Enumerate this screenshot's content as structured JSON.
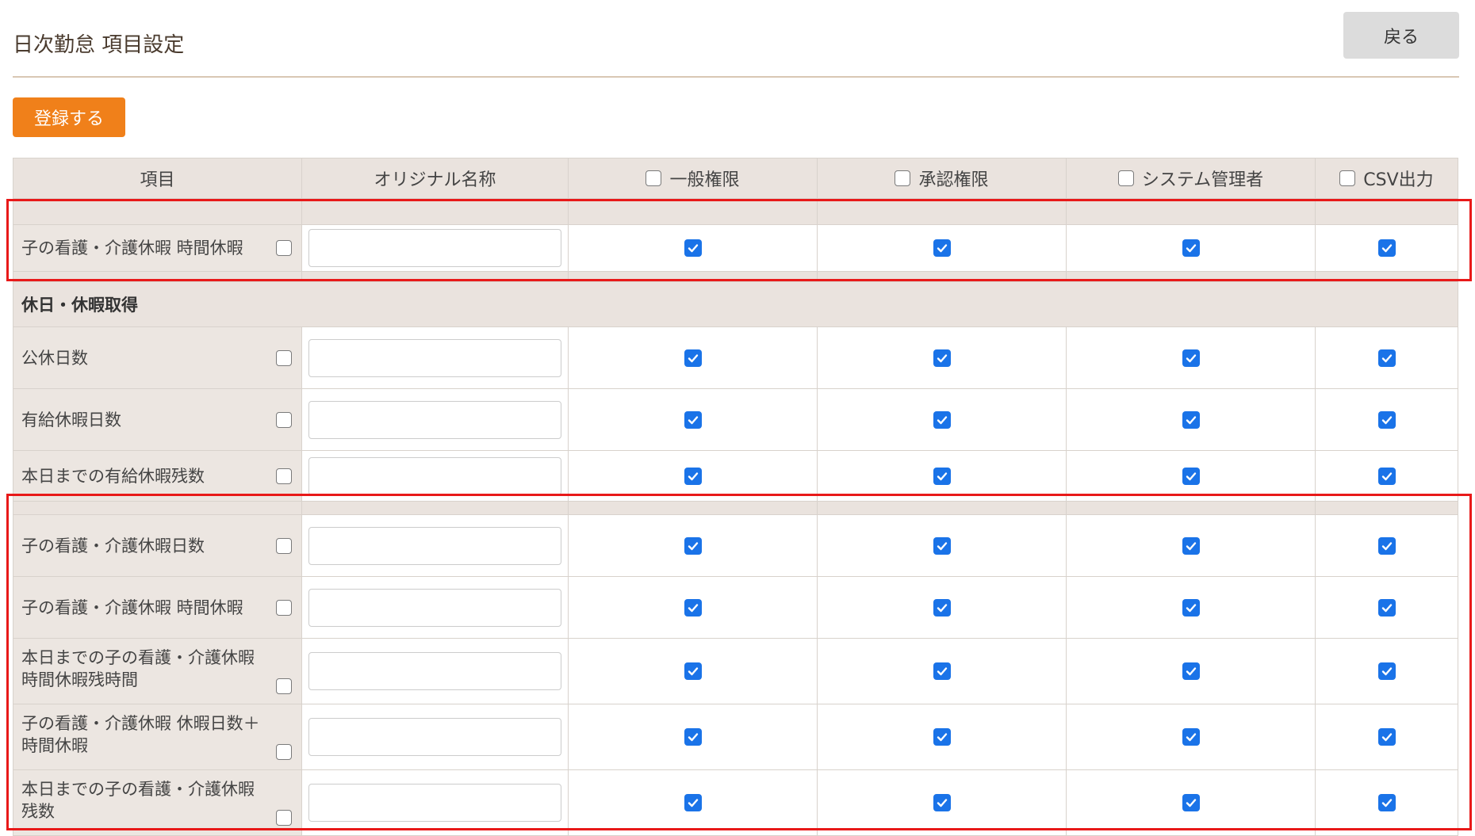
{
  "page": {
    "title": "日次勤怠 項目設定",
    "back_label": "戻る",
    "register_label": "登録する"
  },
  "table": {
    "headers": {
      "item": "項目",
      "original_name": "オリジナル名称",
      "general": "一般権限",
      "approval": "承認権限",
      "system_admin": "システム管理者",
      "csv": "CSV出力"
    },
    "top_row": {
      "label": "子の看護・介護休暇 時間休暇",
      "item_checked": false,
      "original_name": "",
      "general": true,
      "approval": true,
      "system_admin": true,
      "csv": true
    },
    "section": {
      "title": "休日・休暇取得",
      "rows": [
        {
          "label": "公休日数",
          "item_checked": false,
          "original_name": "",
          "general": true,
          "approval": true,
          "system_admin": true,
          "csv": true
        },
        {
          "label": "有給休暇日数",
          "item_checked": false,
          "original_name": "",
          "general": true,
          "approval": true,
          "system_admin": true,
          "csv": true
        },
        {
          "label": "本日までの有給休暇残数",
          "item_checked": false,
          "original_name": "",
          "general": true,
          "approval": true,
          "system_admin": true,
          "csv": true
        },
        {
          "label": "子の看護・介護休暇日数",
          "item_checked": false,
          "original_name": "",
          "general": true,
          "approval": true,
          "system_admin": true,
          "csv": true
        },
        {
          "label": "子の看護・介護休暇 時間休暇",
          "item_checked": false,
          "original_name": "",
          "general": true,
          "approval": true,
          "system_admin": true,
          "csv": true
        },
        {
          "label_line1": "本日までの子の看護・介護休暇",
          "label_line2": "時間休暇残時間",
          "item_checked": false,
          "original_name": "",
          "general": true,
          "approval": true,
          "system_admin": true,
          "csv": true
        },
        {
          "label_line1": "子の看護・介護休暇 休暇日数＋",
          "label_line2": "時間休暇",
          "item_checked": false,
          "original_name": "",
          "general": true,
          "approval": true,
          "system_admin": true,
          "csv": true
        },
        {
          "label_line1": "本日までの子の看護・介護休暇",
          "label_line2": "残数",
          "item_checked": false,
          "original_name": "",
          "general": true,
          "approval": true,
          "system_admin": true,
          "csv": true
        }
      ]
    }
  },
  "colors": {
    "accent_orange": "#f0801a",
    "checkbox_blue": "#1a73e8",
    "highlight_red": "#e81919",
    "header_bg": "#eae3de"
  }
}
